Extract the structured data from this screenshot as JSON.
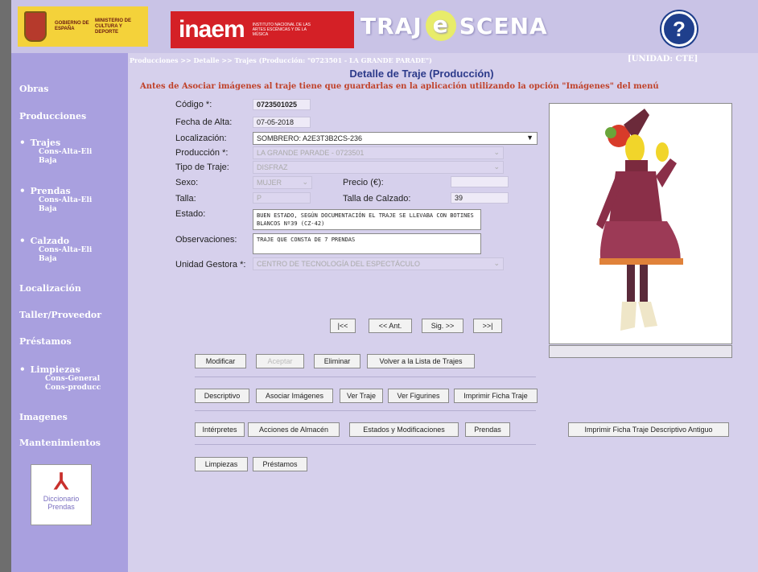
{
  "banner": {
    "gob_line1": "GOBIERNO DE ESPAÑA",
    "gob_line2": "MINISTERIO DE CULTURA Y DEPORTE",
    "inaem": "inaem",
    "inaem_sub": "INSTITUTO NACIONAL DE LAS ARTES ESCÉNICAS Y DE LA MÚSICA",
    "app_left": "TRAJ",
    "app_mid": "e",
    "app_right": "SCENA",
    "help": "?"
  },
  "breadcrumb": "Producciones >> Detalle >> Trajes (Producción: \"0723501 - LA GRANDE PARADE\")",
  "unidad": "[UNIDAD: CTE]",
  "sidebar": {
    "obras": "Obras",
    "producciones": "Producciones",
    "trajes": "Trajes",
    "trajes_sub1": "Cons-Alta-Eli",
    "trajes_sub2": "Baja",
    "prendas": "Prendas",
    "prendas_sub1": "Cons-Alta-Eli",
    "prendas_sub2": "Baja",
    "calzado": "Calzado",
    "calzado_sub1": "Cons-Alta-Eli",
    "calzado_sub2": "Baja",
    "localizacion": "Localización",
    "taller": "Taller/Proveedor",
    "prestamos": "Préstamos",
    "limpiezas": "Limpiezas",
    "limpiezas_sub1": "Cons-General",
    "limpiezas_sub2": "Cons-producc",
    "imagenes": "Imagenes",
    "mantenimientos": "Mantenimientos",
    "pdf_line1": "Diccionario",
    "pdf_line2": "Prendas"
  },
  "form": {
    "title": "Detalle de Traje (Producción)",
    "warning": "Antes de Asociar imágenes al traje tiene que guardarlas en la aplicación utilizando la opción \"Imágenes\" del menú",
    "codigo_label": "Código *:",
    "codigo": "0723501025",
    "fecha_label": "Fecha de Alta:",
    "fecha": "07-05-2018",
    "localizacion_label": "Localización:",
    "localizacion": "SOMBRERO: A2E3T3B2CS-236",
    "produccion_label": "Producción *:",
    "produccion": "LA GRANDE PARADE - 0723501",
    "tipo_label": "Tipo de Traje:",
    "tipo": "DISFRAZ",
    "sexo_label": "Sexo:",
    "sexo": "MUJER",
    "precio_label": "Precio (€):",
    "precio": "",
    "talla_label": "Talla:",
    "talla": "P",
    "calzado_label": "Talla de Calzado:",
    "calzado": "39",
    "estado_label": "Estado:",
    "estado": "BUEN ESTADO, SEGÚN DOCUMENTACIÓN EL TRAJE SE LLEVABA CON BOTINES BLANCOS Nº39 (CZ-42)",
    "obs_label": "Observaciones:",
    "obs": "TRAJE QUE CONSTA DE 7 PRENDAS",
    "unidad_label": "Unidad Gestora *:",
    "unidad": "CENTRO DE TECNOLOGÍA DEL ESPECTÁCULO"
  },
  "nav_buttons": {
    "first": "|<<",
    "prev": "<< Ant.",
    "next": "Sig. >>",
    "last": ">>|"
  },
  "buttons": {
    "modificar": "Modificar",
    "aceptar": "Aceptar",
    "eliminar": "Eliminar",
    "volver": "Volver a la Lista de Trajes",
    "descriptivo": "Descriptivo",
    "asociar": "Asociar Imágenes",
    "ver_traje": "Ver Traje",
    "ver_figurines": "Ver Figurines",
    "imprimir_ficha": "Imprimir Ficha Traje",
    "interpretes": "Intérpretes",
    "acciones": "Acciones de Almacén",
    "estados": "Estados y Modificaciones",
    "prendas": "Prendas",
    "imprimir_antiguo": "Imprimir Ficha Traje Descriptivo Antiguo",
    "limpiezas": "Limpiezas",
    "prestamos": "Préstamos"
  }
}
